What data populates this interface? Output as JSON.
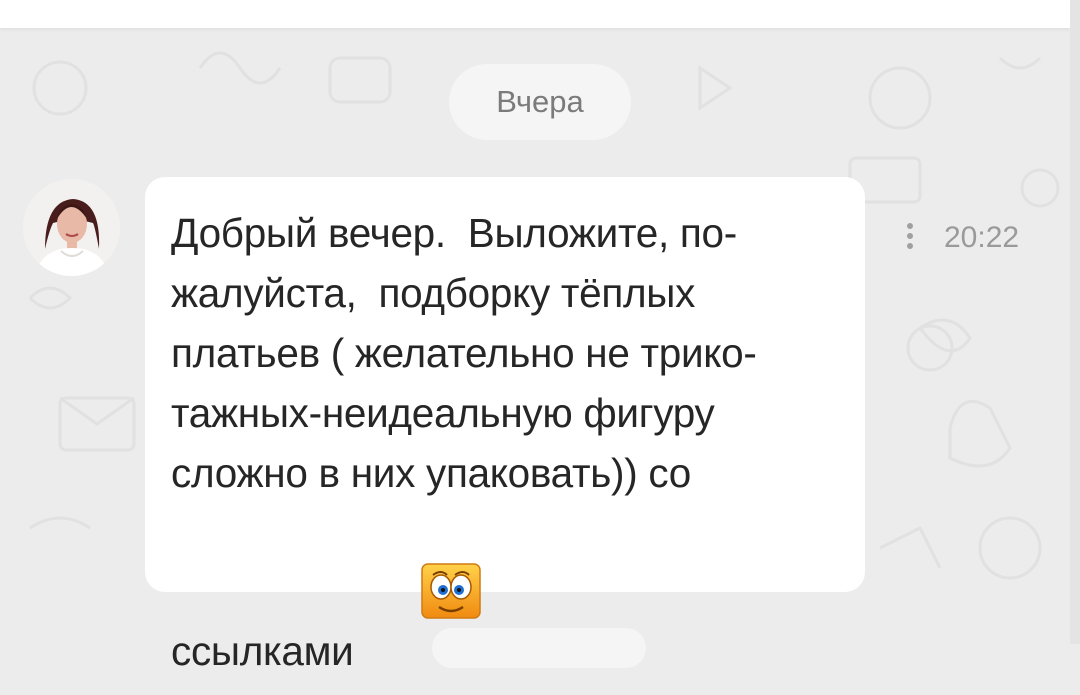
{
  "date_separator": "Вчера",
  "message": {
    "lines": [
      "Добрый вечер.  Выложите, по-",
      "жалуйста,  подборку тёплых",
      "платьев ( желательно не трико-",
      "тажных-неидеальную фигуру",
      "сложно в них упаковать)) со",
      "ссылками"
    ],
    "time": "20:22",
    "emoji_icon": "wide-eyes-emoji-icon"
  },
  "colors": {
    "background": "#ececec",
    "bubble": "#ffffff",
    "text": "#262626",
    "muted": "#9a9a9a"
  }
}
